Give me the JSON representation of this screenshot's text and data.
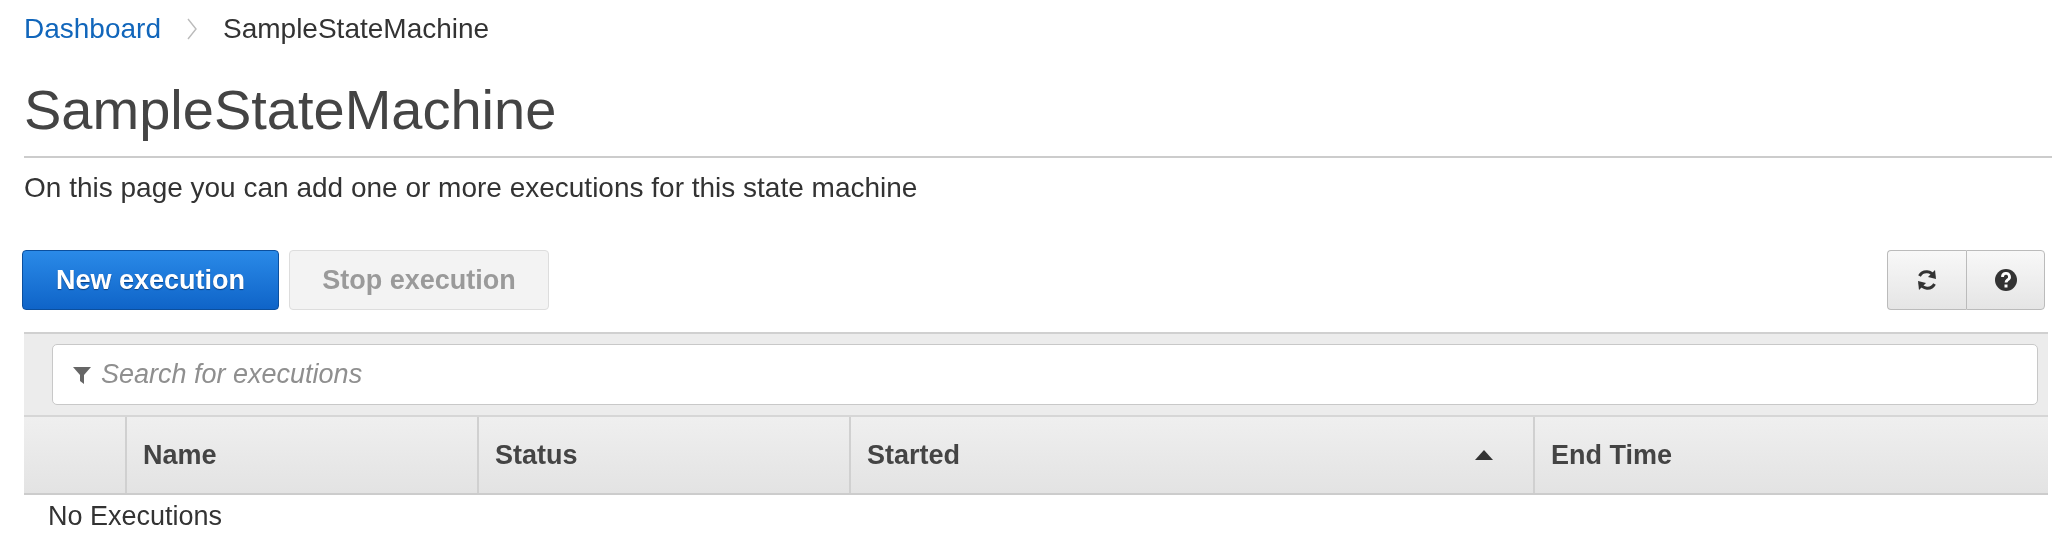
{
  "breadcrumb": [
    {
      "label": "Dashboard",
      "kind": "link"
    },
    {
      "label": "SampleStateMachine",
      "kind": "current"
    }
  ],
  "title": "SampleStateMachine",
  "description": "On this page you can add one or more executions for this state machine",
  "buttons": [
    {
      "label": "New execution",
      "kind": "primary",
      "disabled": false
    },
    {
      "label": "Stop execution",
      "kind": "default",
      "disabled": true
    }
  ],
  "tools": [
    {
      "kind": "refresh"
    },
    {
      "kind": "help"
    }
  ],
  "search": {
    "placeholder": "Search for executions"
  },
  "table": {
    "columns": [
      {
        "label": "Name",
        "sorted": false
      },
      {
        "label": "Status",
        "sorted": false
      },
      {
        "label": "Started",
        "sorted": true
      },
      {
        "label": "End Time",
        "sorted": false
      }
    ],
    "empty_message": "No Executions"
  }
}
